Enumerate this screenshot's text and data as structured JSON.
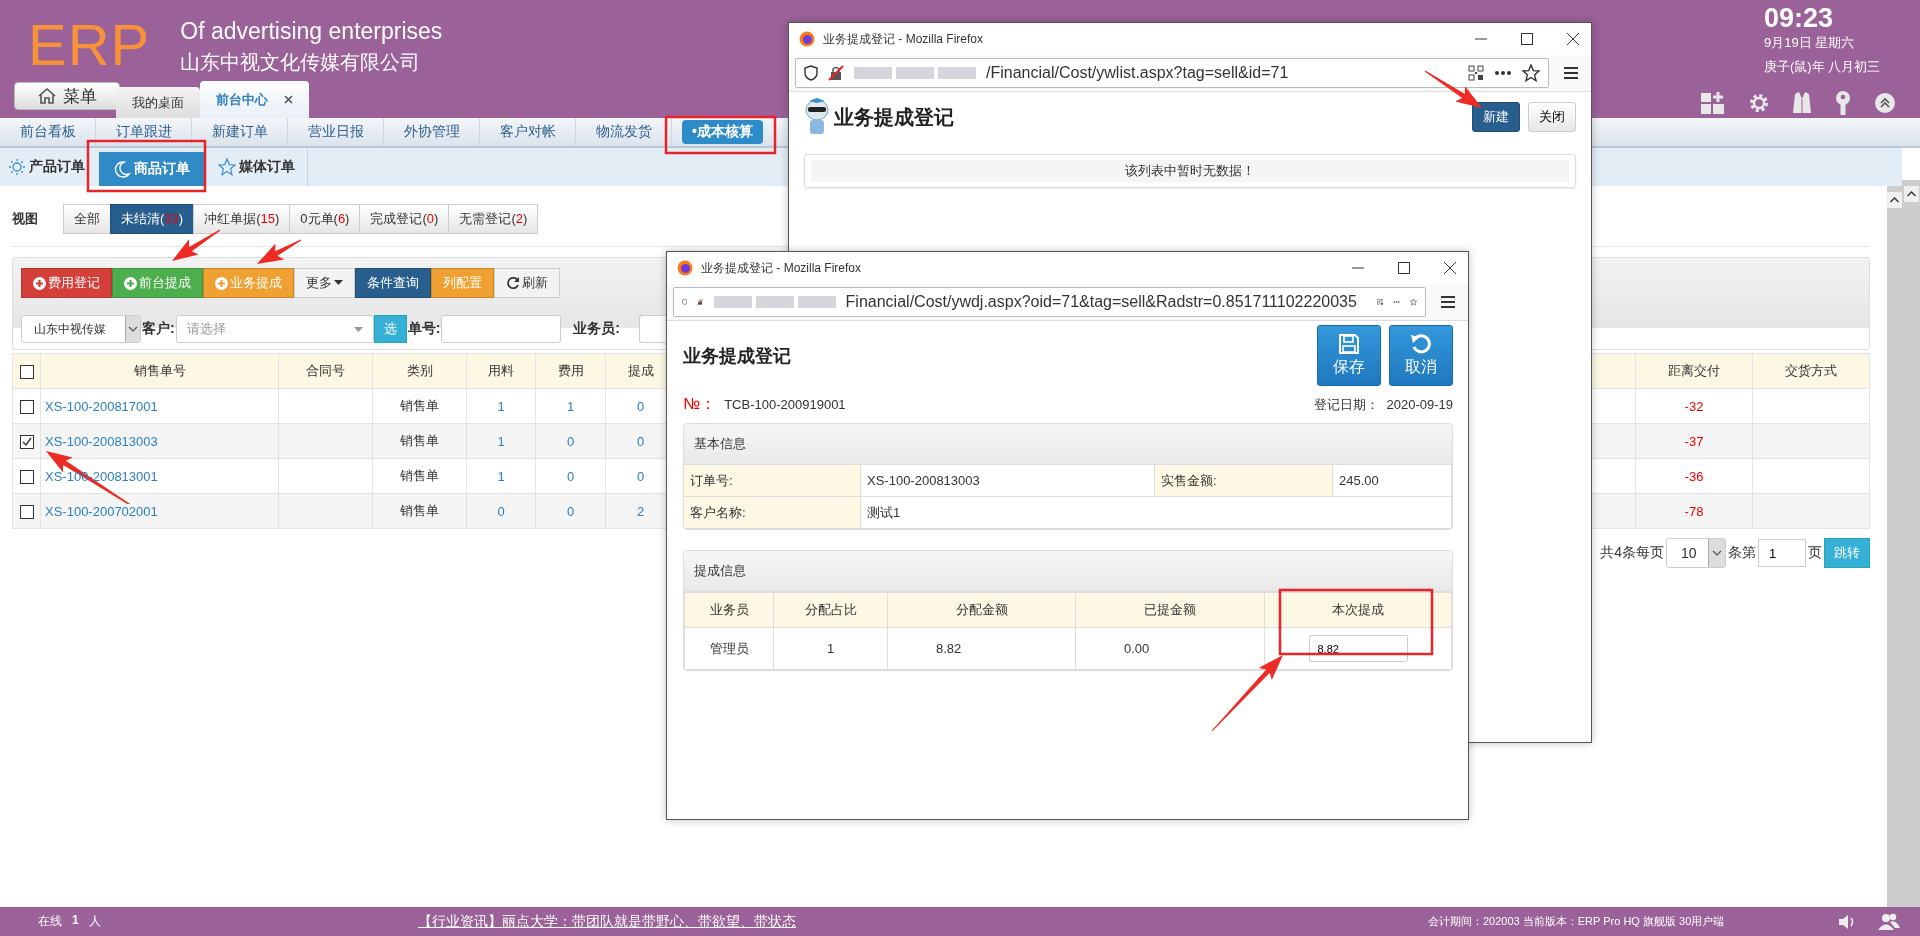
{
  "header": {
    "logo": "ERP",
    "slogan": "Of advertising enterprises",
    "company": "山东中视文化传媒有限公司",
    "menu_button": "菜单",
    "tabs": [
      {
        "label": "我的桌面",
        "selected": false,
        "closable": false
      },
      {
        "label": "前台中心",
        "selected": true,
        "closable": true
      }
    ],
    "clock": {
      "time": "09:23",
      "date": "9月19日 星期六",
      "lunar": "庚子(鼠)年 八月初三"
    }
  },
  "nav": [
    {
      "label": "前台看板",
      "selected": false
    },
    {
      "label": "订单跟进",
      "selected": false
    },
    {
      "label": "新建订单",
      "selected": false
    },
    {
      "label": "营业日报",
      "selected": false
    },
    {
      "label": "外协管理",
      "selected": false
    },
    {
      "label": "客户对帐",
      "selected": false
    },
    {
      "label": "物流发货",
      "selected": false
    },
    {
      "label": "•成本核算",
      "selected": true
    }
  ],
  "subtabs": [
    {
      "label": "产品订单",
      "kind": "sun",
      "selected": false
    },
    {
      "label": "商品订单",
      "kind": "moon",
      "selected": true
    },
    {
      "label": "媒体订单",
      "kind": "star",
      "selected": false
    }
  ],
  "views": {
    "label": "视图",
    "items": [
      {
        "text": "全部",
        "selected": false
      },
      {
        "text": "未结清(33)",
        "selected": true
      },
      {
        "text": "冲红单据(15)",
        "selected": false
      },
      {
        "text": "0元单(6)",
        "selected": false
      },
      {
        "text": "完成登记(0)",
        "selected": false
      },
      {
        "text": "无需登记(2)",
        "selected": false
      }
    ]
  },
  "toolbar": [
    {
      "label": "费用登记",
      "kind": "add",
      "color": "#d43f3a"
    },
    {
      "label": "前台提成",
      "kind": "add",
      "color": "#4cae4c"
    },
    {
      "label": "业务提成",
      "kind": "add",
      "color": "#f0a030"
    },
    {
      "label": "更多",
      "kind": "menu",
      "color": "#f2f2f2"
    },
    {
      "label": "条件查询",
      "kind": "plain",
      "color": "#285e8e"
    },
    {
      "label": "列配置",
      "kind": "plain",
      "color": "#f0a030"
    },
    {
      "label": "刷新",
      "kind": "refresh",
      "color": "#f2f2f2"
    }
  ],
  "filters": {
    "company": "山东中视传媒",
    "customer_label": "客户:",
    "customer_placeholder": "请选择",
    "pick_button": "选",
    "order_label": "单号:",
    "staff_label": "业务员:"
  },
  "table": {
    "all_checked": false,
    "columns": [
      "销售单号",
      "合同号",
      "类别",
      "用料",
      "费用",
      "提成",
      "距离交付",
      "交货方式"
    ],
    "rows": [
      {
        "checked": false,
        "order_no": "XS-100-200817001",
        "type": "销售单",
        "material": "1",
        "fee": "1",
        "commission": "0",
        "days_to_delivery": "-32"
      },
      {
        "checked": true,
        "order_no": "XS-100-200813003",
        "type": "销售单",
        "material": "1",
        "fee": "0",
        "commission": "0",
        "days_to_delivery": "-37"
      },
      {
        "checked": false,
        "order_no": "XS-100-200813001",
        "type": "销售单",
        "material": "1",
        "fee": "0",
        "commission": "0",
        "days_to_delivery": "-36"
      },
      {
        "checked": false,
        "order_no": "XS-100-200702001",
        "type": "销售单",
        "material": "0",
        "fee": "0",
        "commission": "2",
        "days_to_delivery": "-78"
      }
    ]
  },
  "pagination": {
    "summary": "共4条每页",
    "page_size": "10",
    "page_prefix": "条第",
    "page": "1",
    "page_suffix": "页",
    "go_button": "跳转"
  },
  "list_window": {
    "title": "业务提成登记 - Mozilla Firefox",
    "url": "/Financial/Cost/ywlist.aspx?tag=sell&id=71",
    "heading": "业务提成登记",
    "buttons": [
      {
        "label": "新建",
        "kind": "primary"
      },
      {
        "label": "关闭",
        "kind": "default"
      }
    ],
    "empty_message": "该列表中暂时无数据！"
  },
  "form_window": {
    "title": "业务提成登记 - Mozilla Firefox",
    "url": "Financial/Cost/ywdj.aspx?oid=71&tag=sell&Radstr=0.851711102220035",
    "heading": "业务提成登记",
    "buttons": [
      {
        "label": "保存",
        "kind": "save"
      },
      {
        "label": "取消",
        "kind": "undo"
      }
    ],
    "number_label": "№：",
    "number": "TCB-100-200919001",
    "date_label": "登记日期：",
    "date": "2020-09-19",
    "basic": {
      "title": "基本信息",
      "fields": [
        {
          "label": "订单号:",
          "value": "XS-100-200813003"
        },
        {
          "label": "实售金额:",
          "value": "245.00"
        },
        {
          "label": "客户名称:",
          "value": "测试1"
        }
      ]
    },
    "commission": {
      "title": "提成信息",
      "columns": [
        "业务员",
        "分配占比",
        "分配金额",
        "已提金额",
        "本次提成"
      ],
      "rows": [
        {
          "staff": "管理员",
          "ratio": "1",
          "amount": "8.82",
          "paid": "0.00",
          "current": "8.82"
        }
      ]
    }
  },
  "footer": {
    "online_label": "在线",
    "online_count": "1",
    "online_unit": "人",
    "news": "【行业资讯】丽点大学：带团队就是带野心、带欲望、带状态",
    "version": "会计期间：202003 当前版本：ERP Pro HQ 旗舰版 30用户端"
  }
}
